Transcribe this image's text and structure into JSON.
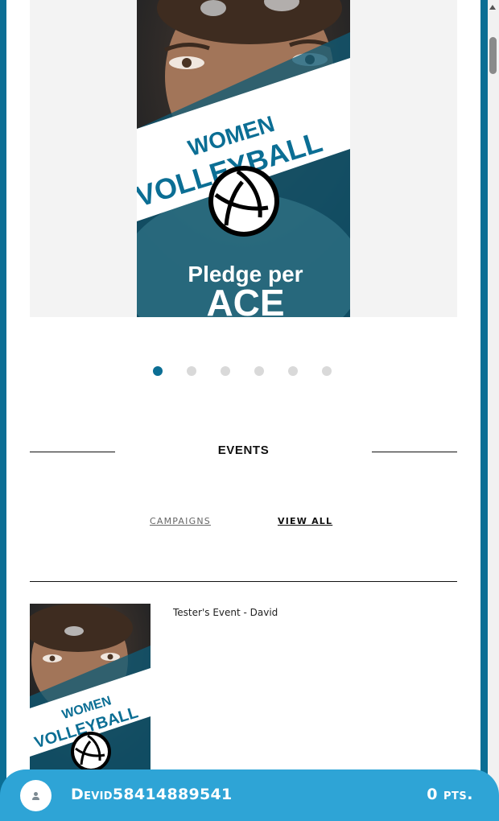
{
  "hero": {
    "poster": {
      "title_line1": "WOMEN",
      "title_line2": "VOLLEYBALL",
      "tagline_line1": "Pledge per",
      "tagline_line2": "ACE"
    },
    "carousel": {
      "total_slides": 6,
      "active_index": 0
    }
  },
  "events_section": {
    "title": "EVENTS",
    "campaigns_link": "CAMPAIGNS",
    "view_all_link": "VIEW ALL"
  },
  "event_list": [
    {
      "name": "Tester's Event - David",
      "poster": {
        "title_line1": "WOMEN",
        "title_line2": "VOLLEYBALL"
      }
    }
  ],
  "user_bar": {
    "username": "Devid58414889541",
    "points": "0 pts."
  },
  "colors": {
    "brand_dark": "#0b6e94",
    "brand_light": "#2ea4d6",
    "poster_band": "#ffffff",
    "poster_text": "#0b6e94"
  },
  "icons": {
    "avatar": "user-avatar-icon",
    "ball": "volleyball-icon",
    "scroll_up": "scroll-up-arrow-icon"
  }
}
